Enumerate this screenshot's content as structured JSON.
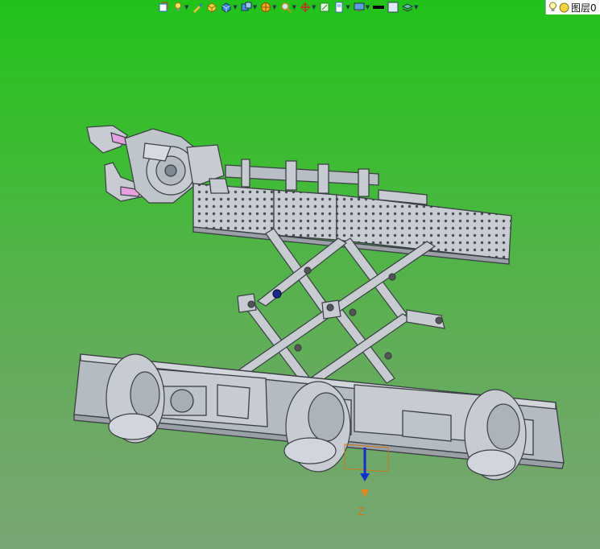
{
  "toolbar": {
    "items": [
      {
        "name": "view-orient-icon"
      },
      {
        "name": "light-icon",
        "has_dropdown": true
      },
      {
        "name": "brush-icon"
      },
      {
        "name": "box-yellow-icon"
      },
      {
        "name": "cube-shaded-icon",
        "has_dropdown": true
      },
      {
        "name": "cube-view-icon",
        "has_dropdown": true
      },
      {
        "name": "section-icon",
        "has_dropdown": true
      },
      {
        "name": "zoom-icon",
        "has_dropdown": true
      },
      {
        "name": "rotate-icon",
        "has_dropdown": true
      },
      {
        "name": "fit-view-icon"
      },
      {
        "name": "door-icon",
        "has_dropdown": true
      },
      {
        "name": "monitor-icon",
        "has_dropdown": true
      },
      {
        "name": "line-color-icon"
      },
      {
        "name": "fill-color-icon"
      },
      {
        "name": "layer-stack-icon",
        "has_dropdown": true
      }
    ]
  },
  "layer": {
    "label": "图层0"
  },
  "viewport": {
    "axis_label": "Z",
    "background_top": "#22c21a",
    "background_bottom": "#7aa575",
    "model_color": "#c8ccd0",
    "model_edge_color": "#3a3f44"
  }
}
